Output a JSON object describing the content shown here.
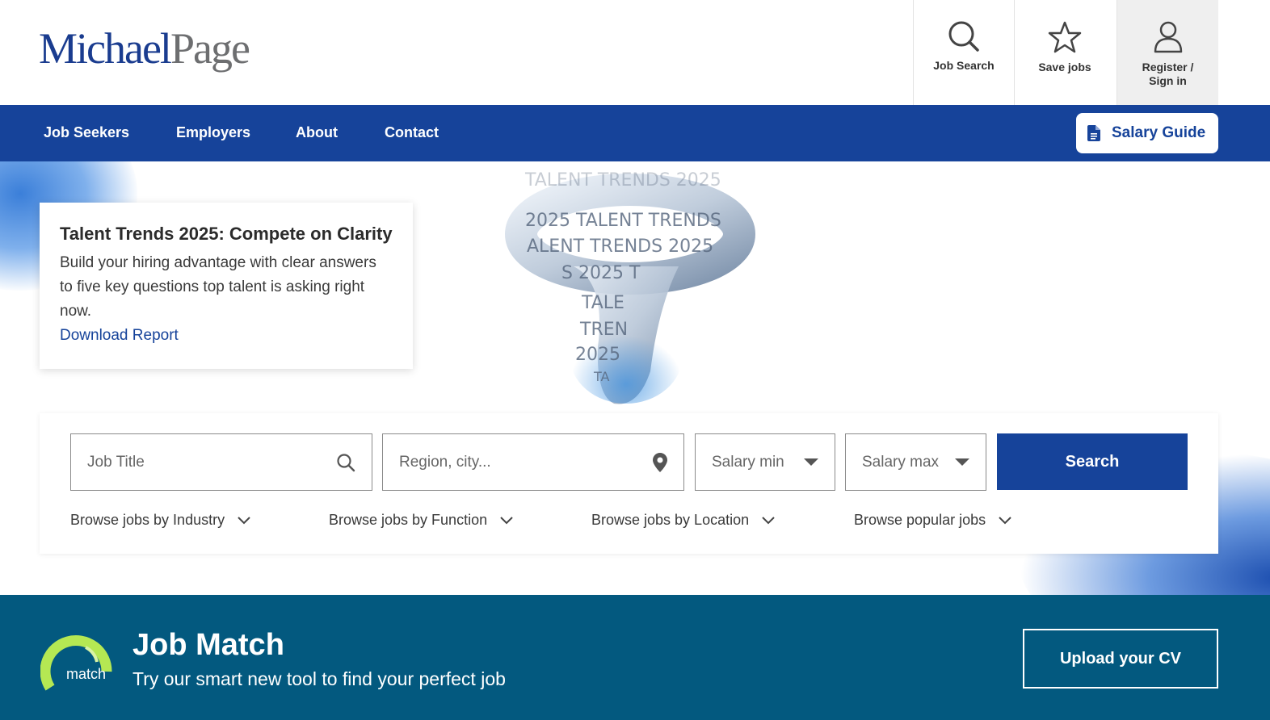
{
  "logo": {
    "part1": "Michael",
    "part2": "Page"
  },
  "utility_nav": {
    "job_search": {
      "label": "Job Search",
      "icon": "search-icon"
    },
    "save_jobs": {
      "label": "Save jobs",
      "icon": "star-icon"
    },
    "register": {
      "label_line1": "Register /",
      "label_line2": "Sign in",
      "icon": "user-icon"
    }
  },
  "main_nav": {
    "items": [
      "Job Seekers",
      "Employers",
      "About",
      "Contact"
    ],
    "salary_guide": {
      "label": "Salary Guide",
      "icon": "document-icon"
    }
  },
  "hero": {
    "title": "Talent Trends 2025: Compete on Clarity",
    "body": "Build your hiring advantage with clear answers to five key questions top talent is asking right now.",
    "link": "Download Report",
    "ring_text": [
      "TALENT TRENDS 2025",
      "2025 TALENT TRENDS",
      "ALENT TRENDS 2025",
      "S 2025 T",
      "TALE",
      "TREN",
      "2025",
      "TA"
    ]
  },
  "search": {
    "job_title_placeholder": "Job Title",
    "location_placeholder": "Region, city...",
    "salary_min": "Salary min",
    "salary_max": "Salary max",
    "button": "Search",
    "browse": [
      "Browse jobs by Industry",
      "Browse jobs by Function",
      "Browse jobs by Location",
      "Browse popular jobs"
    ]
  },
  "job_match": {
    "logo_text": "match",
    "title": "Job Match",
    "subtitle": "Try our smart new tool to find your perfect job",
    "button": "Upload your CV"
  },
  "colors": {
    "brand_blue": "#16439a",
    "job_match_bg": "#03597f",
    "match_green": "#b5e853",
    "logo_grey": "#6d6e70"
  }
}
